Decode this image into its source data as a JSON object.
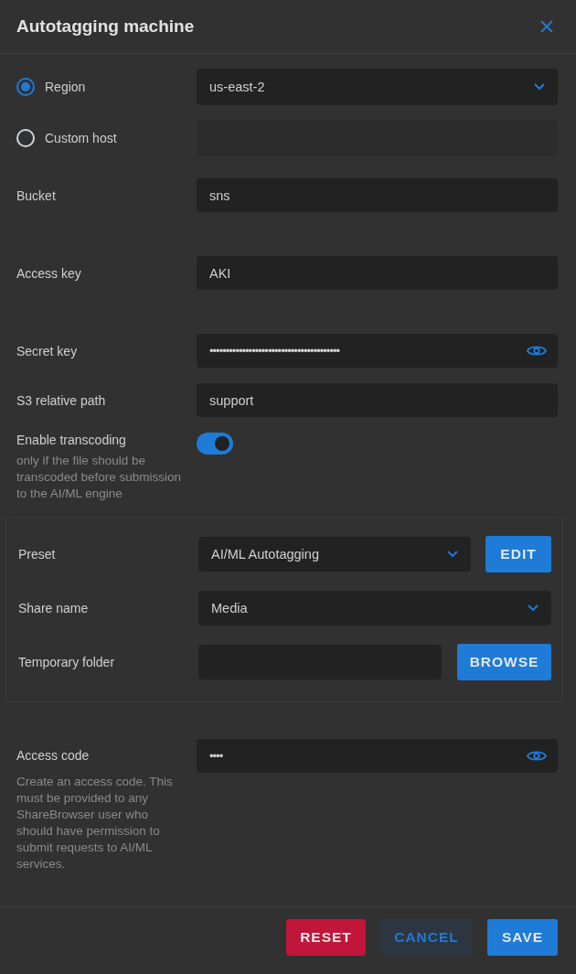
{
  "dialog": {
    "title": "Autotagging machine"
  },
  "endpoint": [
    {
      "label": "Region",
      "selected": true,
      "kind": "select",
      "value": "us-east-2"
    },
    {
      "label": "Custom host",
      "selected": false,
      "kind": "text"
    }
  ],
  "bucket": {
    "label": "Bucket",
    "value": "sns"
  },
  "access_key": {
    "label": "Access key",
    "value": "AKI"
  },
  "secret_key": {
    "label": "Secret key",
    "value": "••••••••••••••••••••••••••••••••••••••••"
  },
  "s3_path": {
    "label": "S3 relative path",
    "value": "support"
  },
  "transcoding": {
    "label": "Enable transcoding",
    "hint": "only if the file should be transcoded before submission to the AI/ML engine",
    "on": true
  },
  "transcoding_settings": {
    "preset": {
      "label": "Preset",
      "value": "AI/ML Autotagging",
      "button": "EDIT"
    },
    "share": {
      "label": "Share name",
      "value": "Media"
    },
    "temp_folder": {
      "label": "Temporary folder",
      "button": "BROWSE"
    }
  },
  "access_code": {
    "label": "Access code",
    "value": "••••",
    "hint": "Create an access code. This must be provided to any ShareBrowser user who should have permission to submit requests to AI/ML services."
  },
  "footer": {
    "buttons": [
      {
        "label": "RESET",
        "kind": "danger"
      },
      {
        "label": "CANCEL",
        "kind": "secondary"
      },
      {
        "label": "SAVE",
        "kind": "primary"
      }
    ]
  }
}
